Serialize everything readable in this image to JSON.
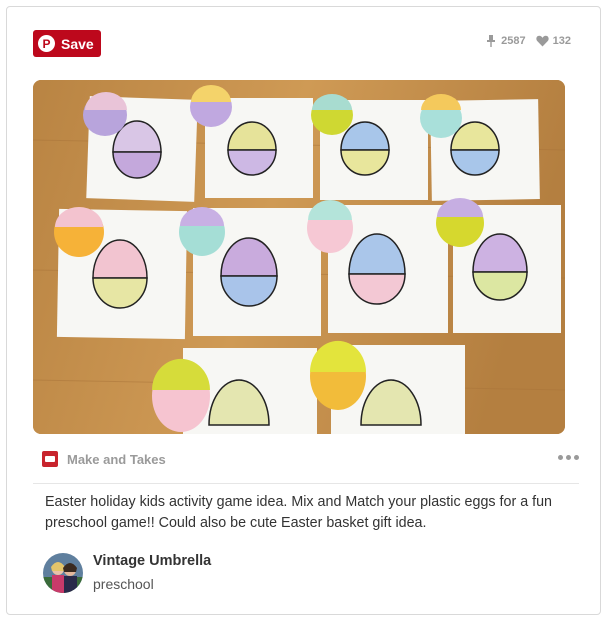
{
  "save_button": {
    "label": "Save"
  },
  "stats": {
    "repins": "2587",
    "likes": "132"
  },
  "source": {
    "name": "Make and Takes"
  },
  "description": "Easter holiday kids activity game idea. Mix and Match your plastic eggs for a fun preschool game!! Could also be cute Easter basket gift idea.",
  "pinner": {
    "name": "Vintage Umbrella",
    "board": "preschool"
  },
  "colors": {
    "brand": "#bd081c",
    "muted": "#9a9a9a"
  },
  "icons": {
    "pin": "pin-icon",
    "repin": "repin-icon",
    "like": "heart-icon",
    "more": "more-dots-icon"
  }
}
